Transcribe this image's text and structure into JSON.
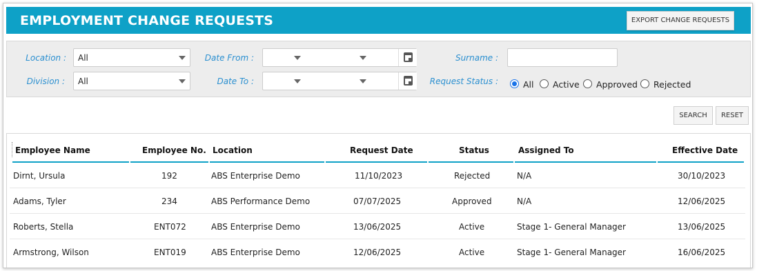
{
  "header": {
    "title": "EMPLOYMENT CHANGE REQUESTS",
    "export_label": "EXPORT CHANGE REQUESTS"
  },
  "filters": {
    "location_label": "Location :",
    "location_value": "All",
    "division_label": "Division :",
    "division_value": "All",
    "date_from_label": "Date From :",
    "date_to_label": "Date To :",
    "surname_label": "Surname :",
    "surname_value": "",
    "request_status_label": "Request Status :",
    "status_options": [
      "All",
      "Active",
      "Approved",
      "Rejected"
    ],
    "status_selected": "All"
  },
  "actions": {
    "search_label": "SEARCH",
    "reset_label": "RESET"
  },
  "table": {
    "columns": [
      "Employee Name",
      "Employee No.",
      "Location",
      "Request Date",
      "Status",
      "Assigned To",
      "Effective Date"
    ],
    "rows": [
      [
        "Dirnt, Ursula",
        "192",
        "ABS Enterprise Demo",
        "11/10/2023",
        "Rejected",
        "N/A",
        "30/10/2023"
      ],
      [
        "Adams, Tyler",
        "234",
        "ABS Performance Demo",
        "07/07/2025",
        "Approved",
        "N/A",
        "12/06/2025"
      ],
      [
        "Roberts, Stella",
        "ENT072",
        "ABS Enterprise Demo",
        "13/06/2025",
        "Active",
        "Stage 1- General Manager",
        "13/06/2025"
      ],
      [
        "Armstrong, Wilson",
        "ENT019",
        "ABS Enterprise Demo",
        "12/06/2025",
        "Active",
        "Stage 1- General Manager",
        "16/06/2025"
      ]
    ]
  },
  "colors": {
    "header_bg": "#0ea1c7",
    "label_blue": "#2a8fd0",
    "radio_accent": "#1a73e8"
  }
}
